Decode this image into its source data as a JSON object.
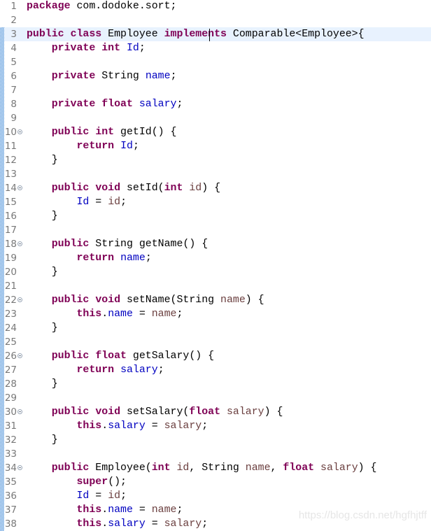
{
  "editor": {
    "current_line": 3,
    "ruler_from_line": 3,
    "colors": {
      "keyword": "#7f0055",
      "field": "#0000c0",
      "param": "#6a3e3e",
      "current_line": "#e8f2fe"
    },
    "lines": [
      {
        "n": "1",
        "tokens": [
          [
            "k",
            "package"
          ],
          [
            "t",
            " com.dodoke.sort;"
          ]
        ]
      },
      {
        "n": "2",
        "tokens": []
      },
      {
        "n": "3",
        "tokens": [
          [
            "k",
            "public"
          ],
          [
            "t",
            " "
          ],
          [
            "k",
            "class"
          ],
          [
            "t",
            " Employee "
          ],
          [
            "k",
            "implements"
          ],
          [
            "t",
            " Comparable<Employee>{"
          ]
        ]
      },
      {
        "n": "4",
        "tokens": [
          [
            "t",
            "    "
          ],
          [
            "k",
            "private"
          ],
          [
            "t",
            " "
          ],
          [
            "k",
            "int"
          ],
          [
            "t",
            " "
          ],
          [
            "f",
            "Id"
          ],
          [
            "t",
            ";"
          ]
        ]
      },
      {
        "n": "5",
        "tokens": []
      },
      {
        "n": "6",
        "tokens": [
          [
            "t",
            "    "
          ],
          [
            "k",
            "private"
          ],
          [
            "t",
            " String "
          ],
          [
            "f",
            "name"
          ],
          [
            "t",
            ";"
          ]
        ]
      },
      {
        "n": "7",
        "tokens": []
      },
      {
        "n": "8",
        "tokens": [
          [
            "t",
            "    "
          ],
          [
            "k",
            "private"
          ],
          [
            "t",
            " "
          ],
          [
            "k",
            "float"
          ],
          [
            "t",
            " "
          ],
          [
            "f",
            "salary"
          ],
          [
            "t",
            ";"
          ]
        ]
      },
      {
        "n": "9",
        "tokens": []
      },
      {
        "n": "10",
        "fold": true,
        "tokens": [
          [
            "t",
            "    "
          ],
          [
            "k",
            "public"
          ],
          [
            "t",
            " "
          ],
          [
            "k",
            "int"
          ],
          [
            "t",
            " getId() {"
          ]
        ]
      },
      {
        "n": "11",
        "tokens": [
          [
            "t",
            "        "
          ],
          [
            "k",
            "return"
          ],
          [
            "t",
            " "
          ],
          [
            "f",
            "Id"
          ],
          [
            "t",
            ";"
          ]
        ]
      },
      {
        "n": "12",
        "tokens": [
          [
            "t",
            "    }"
          ]
        ]
      },
      {
        "n": "13",
        "tokens": []
      },
      {
        "n": "14",
        "fold": true,
        "tokens": [
          [
            "t",
            "    "
          ],
          [
            "k",
            "public"
          ],
          [
            "t",
            " "
          ],
          [
            "k",
            "void"
          ],
          [
            "t",
            " setId("
          ],
          [
            "k",
            "int"
          ],
          [
            "t",
            " "
          ],
          [
            "p",
            "id"
          ],
          [
            "t",
            ") {"
          ]
        ]
      },
      {
        "n": "15",
        "tokens": [
          [
            "t",
            "        "
          ],
          [
            "f",
            "Id"
          ],
          [
            "t",
            " = "
          ],
          [
            "p",
            "id"
          ],
          [
            "t",
            ";"
          ]
        ]
      },
      {
        "n": "16",
        "tokens": [
          [
            "t",
            "    }"
          ]
        ]
      },
      {
        "n": "17",
        "tokens": []
      },
      {
        "n": "18",
        "fold": true,
        "tokens": [
          [
            "t",
            "    "
          ],
          [
            "k",
            "public"
          ],
          [
            "t",
            " String getName() {"
          ]
        ]
      },
      {
        "n": "19",
        "tokens": [
          [
            "t",
            "        "
          ],
          [
            "k",
            "return"
          ],
          [
            "t",
            " "
          ],
          [
            "f",
            "name"
          ],
          [
            "t",
            ";"
          ]
        ]
      },
      {
        "n": "20",
        "tokens": [
          [
            "t",
            "    }"
          ]
        ]
      },
      {
        "n": "21",
        "tokens": []
      },
      {
        "n": "22",
        "fold": true,
        "tokens": [
          [
            "t",
            "    "
          ],
          [
            "k",
            "public"
          ],
          [
            "t",
            " "
          ],
          [
            "k",
            "void"
          ],
          [
            "t",
            " setName(String "
          ],
          [
            "p",
            "name"
          ],
          [
            "t",
            ") {"
          ]
        ]
      },
      {
        "n": "23",
        "tokens": [
          [
            "t",
            "        "
          ],
          [
            "k",
            "this"
          ],
          [
            "t",
            "."
          ],
          [
            "f",
            "name"
          ],
          [
            "t",
            " = "
          ],
          [
            "p",
            "name"
          ],
          [
            "t",
            ";"
          ]
        ]
      },
      {
        "n": "24",
        "tokens": [
          [
            "t",
            "    }"
          ]
        ]
      },
      {
        "n": "25",
        "tokens": []
      },
      {
        "n": "26",
        "fold": true,
        "tokens": [
          [
            "t",
            "    "
          ],
          [
            "k",
            "public"
          ],
          [
            "t",
            " "
          ],
          [
            "k",
            "float"
          ],
          [
            "t",
            " getSalary() {"
          ]
        ]
      },
      {
        "n": "27",
        "tokens": [
          [
            "t",
            "        "
          ],
          [
            "k",
            "return"
          ],
          [
            "t",
            " "
          ],
          [
            "f",
            "salary"
          ],
          [
            "t",
            ";"
          ]
        ]
      },
      {
        "n": "28",
        "tokens": [
          [
            "t",
            "    }"
          ]
        ]
      },
      {
        "n": "29",
        "tokens": []
      },
      {
        "n": "30",
        "fold": true,
        "tokens": [
          [
            "t",
            "    "
          ],
          [
            "k",
            "public"
          ],
          [
            "t",
            " "
          ],
          [
            "k",
            "void"
          ],
          [
            "t",
            " setSalary("
          ],
          [
            "k",
            "float"
          ],
          [
            "t",
            " "
          ],
          [
            "p",
            "salary"
          ],
          [
            "t",
            ") {"
          ]
        ]
      },
      {
        "n": "31",
        "tokens": [
          [
            "t",
            "        "
          ],
          [
            "k",
            "this"
          ],
          [
            "t",
            "."
          ],
          [
            "f",
            "salary"
          ],
          [
            "t",
            " = "
          ],
          [
            "p",
            "salary"
          ],
          [
            "t",
            ";"
          ]
        ]
      },
      {
        "n": "32",
        "tokens": [
          [
            "t",
            "    }"
          ]
        ]
      },
      {
        "n": "33",
        "tokens": []
      },
      {
        "n": "34",
        "fold": true,
        "tokens": [
          [
            "t",
            "    "
          ],
          [
            "k",
            "public"
          ],
          [
            "t",
            " Employee("
          ],
          [
            "k",
            "int"
          ],
          [
            "t",
            " "
          ],
          [
            "p",
            "id"
          ],
          [
            "t",
            ", String "
          ],
          [
            "p",
            "name"
          ],
          [
            "t",
            ", "
          ],
          [
            "k",
            "float"
          ],
          [
            "t",
            " "
          ],
          [
            "p",
            "salary"
          ],
          [
            "t",
            ") {"
          ]
        ]
      },
      {
        "n": "35",
        "tokens": [
          [
            "t",
            "        "
          ],
          [
            "k",
            "super"
          ],
          [
            "t",
            "();"
          ]
        ]
      },
      {
        "n": "36",
        "tokens": [
          [
            "t",
            "        "
          ],
          [
            "f",
            "Id"
          ],
          [
            "t",
            " = "
          ],
          [
            "p",
            "id"
          ],
          [
            "t",
            ";"
          ]
        ]
      },
      {
        "n": "37",
        "tokens": [
          [
            "t",
            "        "
          ],
          [
            "k",
            "this"
          ],
          [
            "t",
            "."
          ],
          [
            "f",
            "name"
          ],
          [
            "t",
            " = "
          ],
          [
            "p",
            "name"
          ],
          [
            "t",
            ";"
          ]
        ]
      },
      {
        "n": "38",
        "tokens": [
          [
            "t",
            "        "
          ],
          [
            "k",
            "this"
          ],
          [
            "t",
            "."
          ],
          [
            "f",
            "salary"
          ],
          [
            "t",
            " = "
          ],
          [
            "p",
            "salary"
          ],
          [
            "t",
            ";"
          ]
        ]
      }
    ]
  },
  "watermark": "https://blog.csdn.net/hgfhjtff"
}
